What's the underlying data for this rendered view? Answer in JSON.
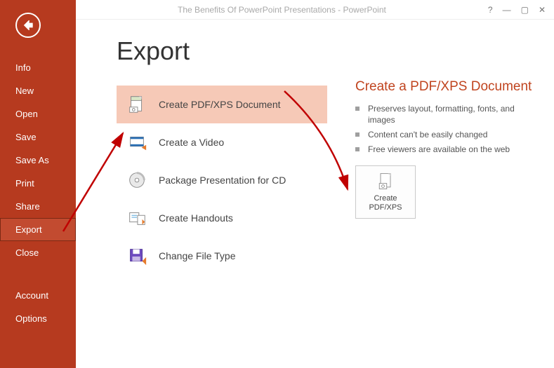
{
  "window": {
    "title": "The Benefits Of PowerPoint Presentations - PowerPoint"
  },
  "sidebar": {
    "items": [
      "Info",
      "New",
      "Open",
      "Save",
      "Save As",
      "Print",
      "Share",
      "Export",
      "Close"
    ],
    "selected": "Export",
    "footer": [
      "Account",
      "Options"
    ]
  },
  "page": {
    "title": "Export",
    "options": [
      "Create PDF/XPS Document",
      "Create a Video",
      "Package Presentation for CD",
      "Create Handouts",
      "Change File Type"
    ],
    "selected_option": "Create PDF/XPS Document"
  },
  "detail": {
    "heading": "Create a PDF/XPS Document",
    "bullets": [
      "Preserves layout, formatting, fonts, and images",
      "Content can't be easily changed",
      "Free viewers are available on the web"
    ],
    "button_line1": "Create",
    "button_line2": "PDF/XPS"
  }
}
